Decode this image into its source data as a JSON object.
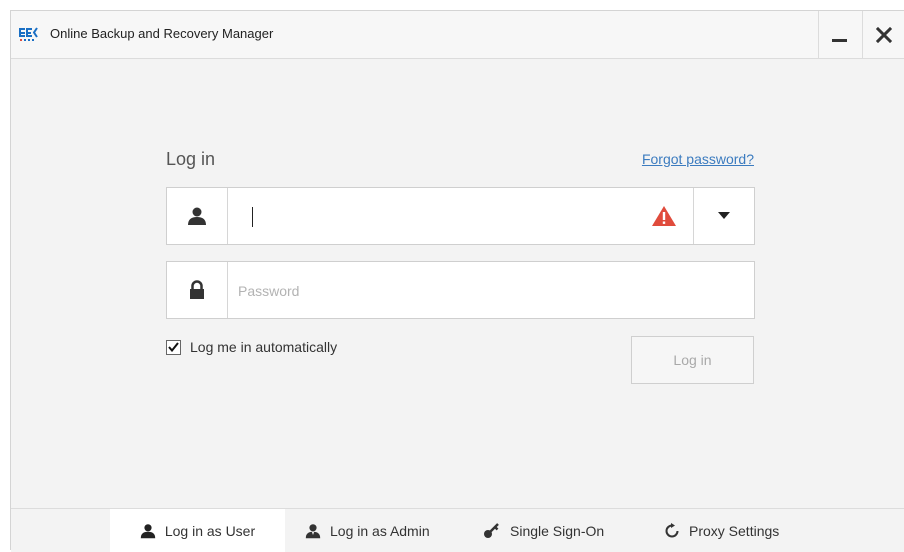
{
  "window": {
    "title": "Online Backup and Recovery Manager",
    "logo_text": "BEK"
  },
  "login": {
    "heading": "Log in",
    "forgot_password": "Forgot password?",
    "username_value": "",
    "password_placeholder": "Password",
    "auto_login_label": "Log me in automatically",
    "auto_login_checked": true,
    "login_button": "Log in"
  },
  "tabs": [
    {
      "label": "Log in as User",
      "icon": "user-icon",
      "active": true
    },
    {
      "label": "Log in as Admin",
      "icon": "admin-user-icon",
      "active": false
    },
    {
      "label": "Single Sign-On",
      "icon": "key-icon",
      "active": false
    },
    {
      "label": "Proxy Settings",
      "icon": "refresh-icon",
      "active": false
    }
  ],
  "colors": {
    "link": "#3b7bbf",
    "warning": "#e04b3c",
    "logo_blue": "#1a6fc4"
  }
}
